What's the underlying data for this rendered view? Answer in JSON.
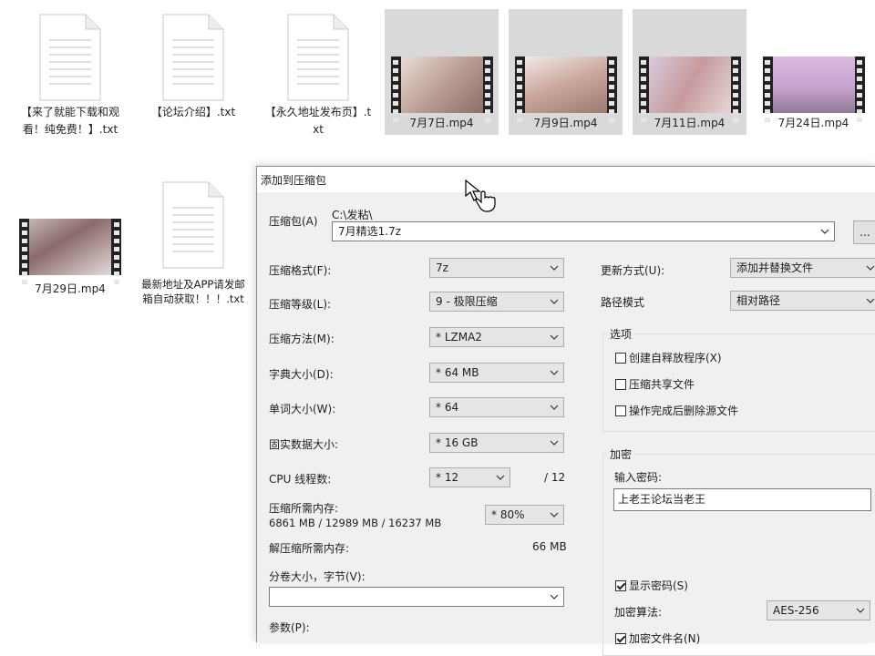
{
  "files": [
    {
      "kind": "doc",
      "name": "【来了就能下载和观看！纯免费！】.txt"
    },
    {
      "kind": "doc",
      "name": "【论坛介绍】.txt"
    },
    {
      "kind": "doc",
      "name": "【永久地址发布页】.txt"
    },
    {
      "kind": "video",
      "name": "7月7日.mp4"
    },
    {
      "kind": "video",
      "name": "7月9日.mp4"
    },
    {
      "kind": "video",
      "name": "7月11日.mp4"
    },
    {
      "kind": "video",
      "name": "7月24日.mp4"
    },
    {
      "kind": "video",
      "name": "7月29日.mp4"
    },
    {
      "kind": "doc",
      "name": "最新地址及APP请发邮箱自动获取！！！.txt"
    }
  ],
  "dialog": {
    "title": "添加到压缩包",
    "archive_label": "压缩包(A)",
    "archive_path": "C:\\发粘\\",
    "archive_name": "7月精选1.7z",
    "browse_label": "...",
    "format_label": "压缩格式(F):",
    "format_value": "7z",
    "level_label": "压缩等级(L):",
    "level_value": "9 - 极限压缩",
    "method_label": "压缩方法(M):",
    "method_value": "* LZMA2",
    "dict_label": "字典大小(D):",
    "dict_value": "* 64 MB",
    "word_label": "单词大小(W):",
    "word_value": "* 64",
    "solid_label": "固实数据大小:",
    "solid_value": "* 16 GB",
    "cpu_label": "CPU 线程数:",
    "cpu_value": "* 12",
    "cpu_total": "/ 12",
    "mem_label": "压缩所需内存:",
    "mem_values": "6861 MB / 12989 MB / 16237 MB",
    "mem_percent": "* 80%",
    "decomp_label": "解压缩所需内存:",
    "decomp_value": "66 MB",
    "split_label": "分卷大小，字节(V):",
    "split_value": "",
    "params_label": "参数(P):",
    "update_label": "更新方式(U):",
    "update_value": "添加并替换文件",
    "path_label": "路径模式",
    "path_value": "相对路径",
    "options_title": "选项",
    "opt_sfx": "创建自释放程序(X)",
    "opt_shared": "压缩共享文件",
    "opt_delete": "操作完成后删除源文件",
    "encrypt_title": "加密",
    "password_label": "输入密码:",
    "password_value": "上老王论坛当老王",
    "show_password": "显示密码(S)",
    "enc_method_label": "加密算法:",
    "enc_method_value": "AES-256",
    "enc_names": "加密文件名(N)"
  },
  "colors": {
    "selected_bg": "#d9d9d9",
    "dialog_bg": "#f0f0f0"
  }
}
